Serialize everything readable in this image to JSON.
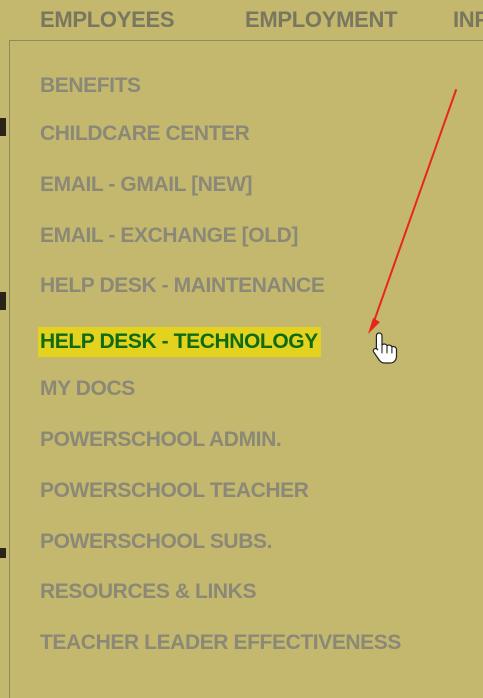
{
  "top_nav": {
    "items": [
      "EMPLOYEES",
      "EMPLOYMENT",
      "INF"
    ]
  },
  "dropdown": {
    "items": [
      "BENEFITS",
      "CHILDCARE CENTER",
      "EMAIL - GMAIL [NEW]",
      "EMAIL - EXCHANGE [OLD]",
      "HELP DESK - MAINTENANCE",
      "HELP DESK - TECHNOLOGY",
      "MY DOCS",
      "POWERSCHOOL ADMIN.",
      "POWERSCHOOL TEACHER",
      "POWERSCHOOL SUBS.",
      "RESOURCES & LINKS",
      "TEACHER LEADER EFFECTIVENESS"
    ]
  },
  "colors": {
    "menu_background": "#c3b86d",
    "menu_text": "#8b8877",
    "highlight_background": "#e3d31f",
    "highlight_text": "#0f6a12",
    "arrow": "#e8261c"
  },
  "icons": {
    "pointer": "hand-pointer-icon",
    "arrow": "red-arrow-icon"
  }
}
